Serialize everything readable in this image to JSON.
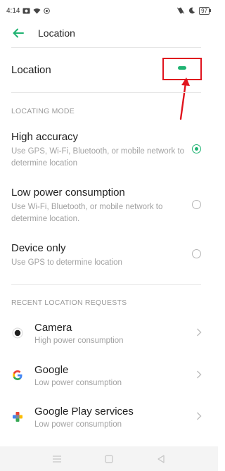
{
  "status_bar": {
    "time": "4:14",
    "battery": "97",
    "icons": [
      "image-icon",
      "wifi-icon",
      "circle-icon",
      "vibrate-icon",
      "moon-icon",
      "battery-icon"
    ]
  },
  "header": {
    "title": "Location",
    "back_icon": "arrow-left-icon"
  },
  "location_toggle": {
    "label": "Location",
    "enabled": true
  },
  "locating_mode": {
    "header": "LOCATING MODE",
    "options": [
      {
        "title": "High accuracy",
        "description": "Use GPS, Wi-Fi, Bluetooth, or mobile network to determine location",
        "selected": true
      },
      {
        "title": "Low power consumption",
        "description": "Use Wi-Fi, Bluetooth, or mobile network to determine location.",
        "selected": false
      },
      {
        "title": "Device only",
        "description": "Use GPS to determine location",
        "selected": false
      }
    ]
  },
  "recent_requests": {
    "header": "RECENT LOCATION REQUESTS",
    "items": [
      {
        "app": "Camera",
        "usage": "High power consumption",
        "icon": "camera-icon"
      },
      {
        "app": "Google",
        "usage": "Low power consumption",
        "icon": "google-g-icon"
      },
      {
        "app": "Google Play services",
        "usage": "Low power consumption",
        "icon": "play-services-icon"
      }
    ]
  },
  "nav_bar": {
    "icons": [
      "menu-icon",
      "home-square-icon",
      "back-triangle-icon"
    ]
  },
  "colors": {
    "accent": "#1fb372",
    "annotation": "#e0141e",
    "secondary_text": "#a2a2a2"
  }
}
